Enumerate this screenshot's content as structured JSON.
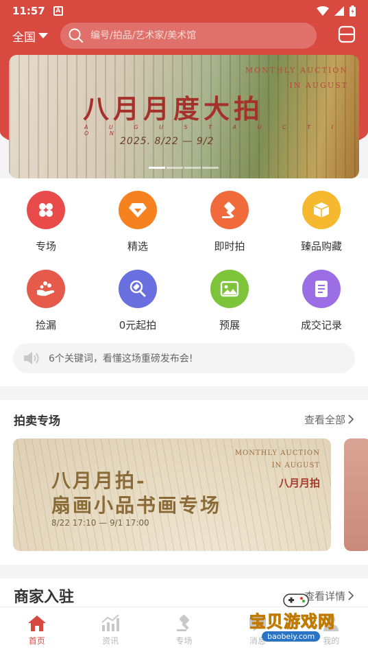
{
  "status_bar": {
    "time": "11:57",
    "badge": "A"
  },
  "header": {
    "region_label": "全国",
    "search_placeholder": "编号/拍品/艺术家/美术馆"
  },
  "banner": {
    "title": "八月月度大拍",
    "subtitle": "A U G U S T A U C T I O N",
    "dates": "2025.  8/22  — 9/2",
    "en_line1": "MONTHLY AUCTION",
    "en_line2": "IN AUGUST"
  },
  "categories": [
    {
      "label": "专场",
      "icon": "grid-icon",
      "color": "#e94b4b"
    },
    {
      "label": "精选",
      "icon": "diamond-icon",
      "color": "#f5821f"
    },
    {
      "label": "即时拍",
      "icon": "gavel-icon",
      "color": "#f06a3c"
    },
    {
      "label": "臻品购藏",
      "icon": "box-icon",
      "color": "#f5b82e"
    },
    {
      "label": "捡漏",
      "icon": "hand-icon",
      "color": "#e55a4a"
    },
    {
      "label": "0元起拍",
      "icon": "auction-icon",
      "color": "#6a6fe0"
    },
    {
      "label": "预展",
      "icon": "image-icon",
      "color": "#7dc43a"
    },
    {
      "label": "成交记录",
      "icon": "document-icon",
      "color": "#9b6ee6"
    }
  ],
  "notice": {
    "text": "6个关键词，看懂这场重磅发布会!"
  },
  "auction_section": {
    "title": "拍卖专场",
    "more_label": "查看全部",
    "card": {
      "title_line1": "八月月拍-",
      "title_line2": "扇画小品书画专场",
      "time": "8/22 17:10 — 9/1 17:00",
      "en_line1": "MONTHLY AUCTION",
      "en_line2": "IN AUGUST",
      "tag": "八月月拍"
    }
  },
  "merchant_section": {
    "title": "商家入驻",
    "more_label": "查看详情"
  },
  "tabbar": [
    {
      "label": "首页",
      "icon": "home-icon",
      "active": true
    },
    {
      "label": "资讯",
      "icon": "chart-icon",
      "active": false
    },
    {
      "label": "专场",
      "icon": "gavel-icon",
      "active": false
    },
    {
      "label": "消息",
      "icon": "message-icon",
      "active": false
    },
    {
      "label": "我的",
      "icon": "user-icon",
      "active": false
    }
  ],
  "watermark": {
    "text": "宝贝游戏网",
    "url": "baobeiy.com"
  },
  "colors": {
    "brand": "#d84a40",
    "text": "#333333",
    "muted": "#666666"
  }
}
